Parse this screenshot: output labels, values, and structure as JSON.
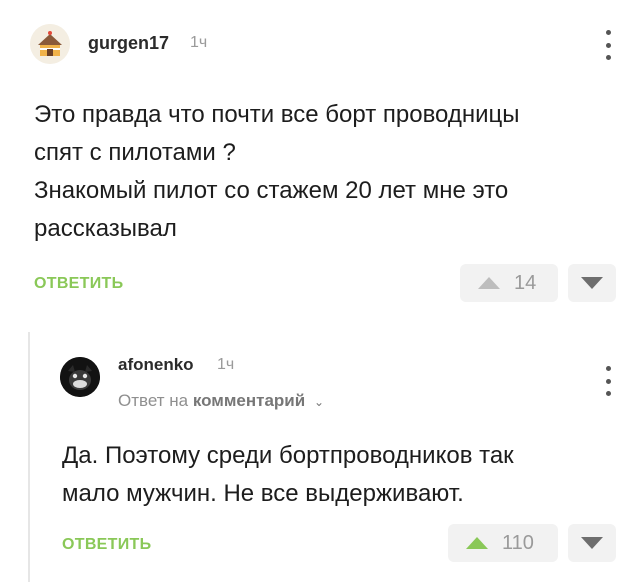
{
  "comments": [
    {
      "username": "gurgen17",
      "time": "1ч",
      "avatar_icon": "cake-house-avatar",
      "lines": [
        "Это правда что почти все борт проводницы",
        "спят с пилотами ?",
        "Знакомый пилот со стажем 20 лет мне это",
        "рассказывал"
      ],
      "reply_label": "ОТВЕТИТЬ",
      "rating": "14"
    },
    {
      "username": "afonenko",
      "time": "1ч",
      "avatar_icon": "dark-creature-avatar",
      "reply_to_prefix": "Ответ на",
      "reply_to_target": "комментарий",
      "lines": [
        "Да. Поэтому среди бортпроводников так",
        "мало мужчин. Не все выдерживают."
      ],
      "reply_label": "ОТВЕТИТЬ",
      "rating": "110"
    }
  ],
  "colors": {
    "accent_green": "#8ac858",
    "vote_bg": "#f2f2f2",
    "muted_text": "#9a9a9a"
  }
}
